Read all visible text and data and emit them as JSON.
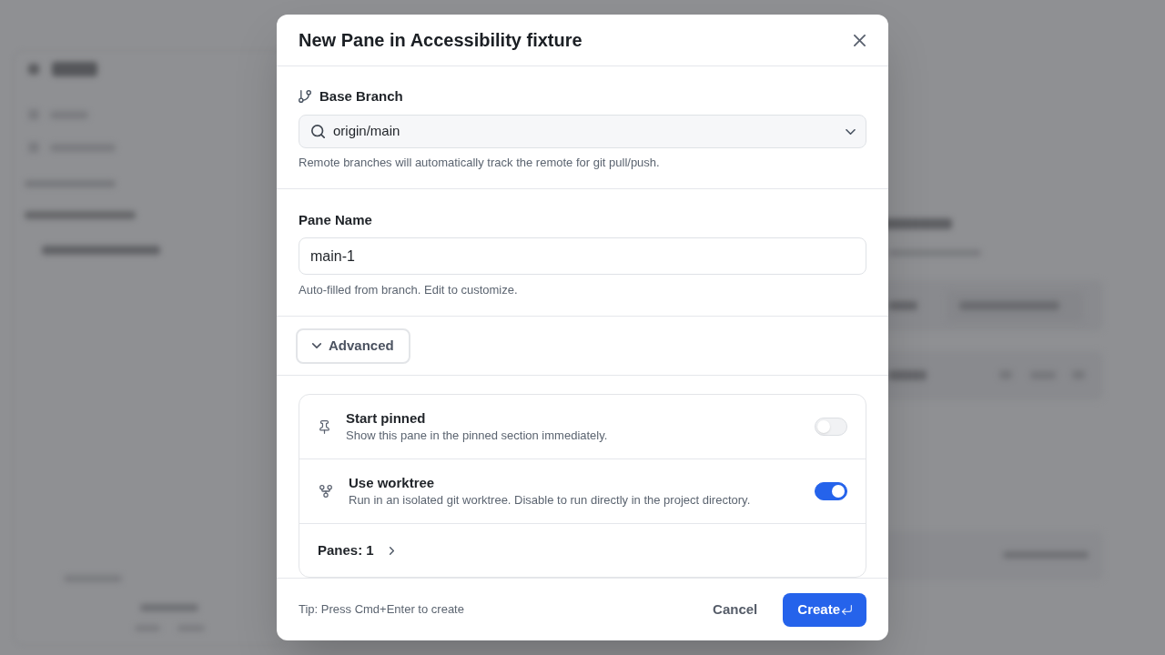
{
  "dialog": {
    "title": "New Pane in Accessibility fixture",
    "base_branch": {
      "label": "Base Branch",
      "value": "origin/main",
      "hint": "Remote branches will automatically track the remote for git pull/push."
    },
    "pane_name": {
      "label": "Pane Name",
      "value": "main-1",
      "hint": "Auto-filled from branch. Edit to customize."
    },
    "advanced": {
      "label": "Advanced",
      "expanded": true
    },
    "options": [
      {
        "kind": "toggle",
        "title": "Start pinned",
        "description": "Show this pane in the pinned section immediately.",
        "on": false
      },
      {
        "kind": "toggle",
        "title": "Use worktree",
        "description": "Run in an isolated git worktree. Disable to run directly in the project directory.",
        "on": true
      },
      {
        "kind": "link",
        "label": "Panes: 1"
      }
    ],
    "footer": {
      "tip": "Tip: Press Cmd+Enter to create",
      "buttons": [
        {
          "kind": "secondary",
          "label": "Cancel"
        },
        {
          "kind": "primary",
          "label": "Create"
        }
      ]
    }
  }
}
